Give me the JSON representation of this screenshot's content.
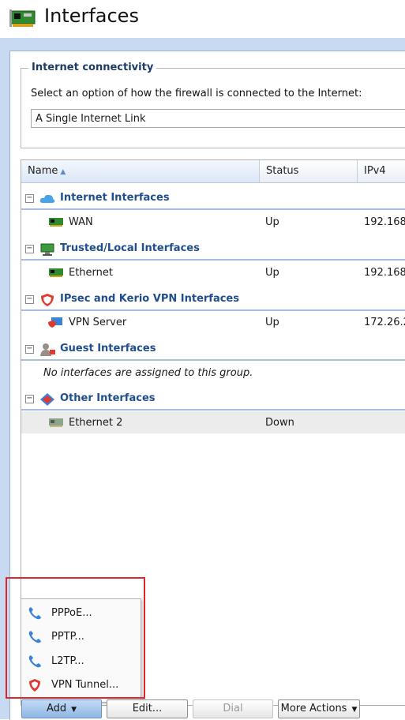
{
  "window": {
    "title": "Interfaces"
  },
  "connectivity": {
    "legend": "Internet connectivity",
    "description": "Select an option of how the firewall is connected to the Internet:",
    "selected_option": "A Single Internet Link"
  },
  "grid": {
    "columns": {
      "name": "Name",
      "status": "Status",
      "ipv4": "IPv4"
    },
    "groups": {
      "internet": {
        "label": "Internet Interfaces",
        "icon": "cloud-icon",
        "items": [
          {
            "name": "WAN",
            "status": "Up",
            "ipv4": "192.168."
          }
        ]
      },
      "trusted": {
        "label": "Trusted/Local Interfaces",
        "icon": "network-icon",
        "items": [
          {
            "name": "Ethernet",
            "status": "Up",
            "ipv4": "192.168."
          }
        ]
      },
      "vpn": {
        "label": "IPsec and Kerio VPN Interfaces",
        "icon": "shield-icon",
        "items": [
          {
            "name": "VPN Server",
            "status": "Up",
            "ipv4": "172.26.2"
          }
        ]
      },
      "guest": {
        "label": "Guest Interfaces",
        "icon": "guest-user-icon",
        "empty_text": "No interfaces are assigned to this group."
      },
      "other": {
        "label": "Other Interfaces",
        "icon": "diamond-icon",
        "items": [
          {
            "name": "Ethernet 2",
            "status": "Down",
            "ipv4": ""
          }
        ]
      }
    }
  },
  "add_menu": {
    "items": [
      {
        "label": "PPPoE...",
        "icon": "phone-icon"
      },
      {
        "label": "PPTP...",
        "icon": "phone-icon"
      },
      {
        "label": "L2TP...",
        "icon": "phone-icon"
      },
      {
        "label": "VPN Tunnel...",
        "icon": "shield-icon"
      }
    ]
  },
  "toolbar": {
    "add": "Add",
    "edit": "Edit...",
    "dial": "Dial",
    "more_actions": "More Actions"
  },
  "colors": {
    "accent": "#1f4e8c",
    "highlight_box": "#e0262a",
    "frame": "#c7daf2"
  }
}
